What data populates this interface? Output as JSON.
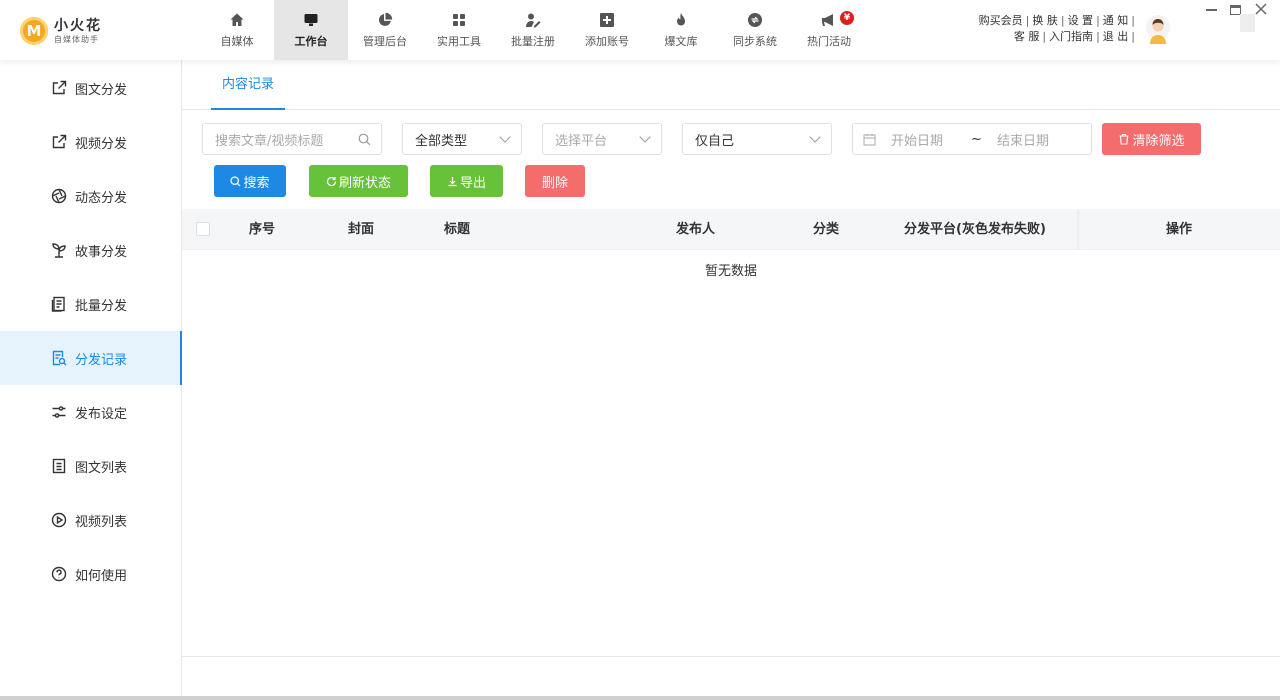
{
  "app": {
    "logo_letter": "M",
    "name": "小火花",
    "subtitle": "自媒体助手",
    "brand_color": "#f5a623",
    "accent_color": "#1e88e5"
  },
  "nav": [
    {
      "label": "自媒体",
      "icon": "home-icon",
      "active": false
    },
    {
      "label": "工作台",
      "icon": "monitor-icon",
      "active": true
    },
    {
      "label": "管理后台",
      "icon": "pie-chart-icon",
      "active": false
    },
    {
      "label": "实用工具",
      "icon": "grid-icon",
      "active": false
    },
    {
      "label": "批量注册",
      "icon": "user-edit-icon",
      "active": false
    },
    {
      "label": "添加账号",
      "icon": "plus-box-icon",
      "active": false
    },
    {
      "label": "爆文库",
      "icon": "flame-icon",
      "active": false
    },
    {
      "label": "同步系统",
      "icon": "sync-icon",
      "active": false
    },
    {
      "label": "热门活动",
      "icon": "megaphone-icon",
      "active": false,
      "badge": "¥"
    }
  ],
  "top_links": {
    "row1": [
      "购买会员",
      "换 肤",
      "设 置",
      "通 知"
    ],
    "row2": [
      "客 服",
      "入门指南",
      "退 出"
    ]
  },
  "sidebar": {
    "items": [
      {
        "label": "图文分发",
        "icon": "external-link-icon",
        "active": false
      },
      {
        "label": "视频分发",
        "icon": "external-link-icon",
        "active": false
      },
      {
        "label": "动态分发",
        "icon": "aperture-icon",
        "active": false
      },
      {
        "label": "故事分发",
        "icon": "sprout-icon",
        "active": false
      },
      {
        "label": "批量分发",
        "icon": "document-stack-icon",
        "active": false
      },
      {
        "label": "分发记录",
        "icon": "document-search-icon",
        "active": true
      },
      {
        "label": "发布设定",
        "icon": "sliders-icon",
        "active": false
      },
      {
        "label": "图文列表",
        "icon": "list-icon",
        "active": false
      },
      {
        "label": "视频列表",
        "icon": "play-circle-icon",
        "active": false
      },
      {
        "label": "如何使用",
        "icon": "help-circle-icon",
        "active": false
      }
    ]
  },
  "tabs": [
    {
      "label": "内容记录",
      "active": true
    }
  ],
  "filters": {
    "search_placeholder": "搜索文章/视频标题",
    "type_value": "全部类型",
    "platform_placeholder": "选择平台",
    "owner_value": "仅自己",
    "start_date_placeholder": "开始日期",
    "date_separator": "~",
    "end_date_placeholder": "结束日期",
    "clear_label": "清除筛选"
  },
  "actions": {
    "search": "搜索",
    "refresh": "刷新状态",
    "export": "导出",
    "delete": "删除"
  },
  "colors": {
    "search_btn": "#1e88e5",
    "refresh_btn": "#67c23a",
    "export_btn": "#67c23a",
    "delete_btn": "#f56c6c",
    "clear_btn": "#f56c6c"
  },
  "table": {
    "columns": [
      "序号",
      "封面",
      "标题",
      "发布人",
      "分类",
      "分发平台(灰色发布失败)",
      "操作"
    ],
    "empty_text": "暂无数据"
  }
}
